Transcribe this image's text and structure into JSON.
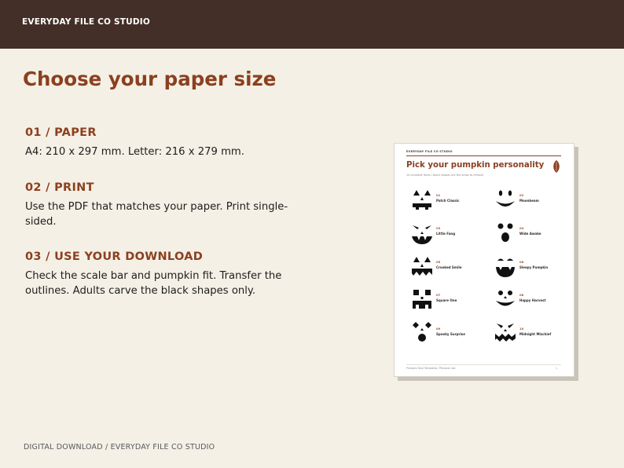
{
  "header": {
    "brand": "EVERYDAY FILE CO STUDIO"
  },
  "main": {
    "title": "Choose your paper size",
    "steps": [
      {
        "heading": "01 / PAPER",
        "body": "A4: 210 x 297 mm. Letter: 216 x 279 mm."
      },
      {
        "heading": "02 / PRINT",
        "body": "Use the PDF that matches your paper. Print single-sided."
      },
      {
        "heading": "03 / USE YOUR DOWNLOAD",
        "body": "Check the scale bar and pumpkin fit. Transfer the outlines. Adults carve the black shapes only."
      }
    ]
  },
  "preview": {
    "brand": "EVERYDAY FILE CO STUDIO",
    "title": "Pick your pumpkin personality",
    "subtitle": "10 printable faces / black shapes are the areas to remove",
    "faces": [
      {
        "num": "01",
        "name": "Patch Classic",
        "icon": "patch-classic-face-icon"
      },
      {
        "num": "02",
        "name": "Moonbeam",
        "icon": "moonbeam-face-icon"
      },
      {
        "num": "03",
        "name": "Little Fang",
        "icon": "little-fang-face-icon"
      },
      {
        "num": "04",
        "name": "Wide Awake",
        "icon": "wide-awake-face-icon"
      },
      {
        "num": "05",
        "name": "Crooked Smile",
        "icon": "crooked-smile-face-icon"
      },
      {
        "num": "06",
        "name": "Sleepy Pumpkin",
        "icon": "sleepy-pumpkin-face-icon"
      },
      {
        "num": "07",
        "name": "Square One",
        "icon": "square-one-face-icon"
      },
      {
        "num": "08",
        "name": "Happy Harvest",
        "icon": "happy-harvest-face-icon"
      },
      {
        "num": "09",
        "name": "Spooky Surprise",
        "icon": "spooky-surprise-face-icon"
      },
      {
        "num": "10",
        "name": "Midnight Mischief",
        "icon": "midnight-mischief-face-icon"
      }
    ],
    "footer": "Pumpkin Face Templates / Personal use",
    "page": "1"
  },
  "footer": {
    "text": "DIGITAL DOWNLOAD / EVERYDAY FILE CO STUDIO"
  },
  "colors": {
    "header_bg": "#432f27",
    "accent": "#8b4020",
    "page_bg": "#f5f0e5"
  }
}
